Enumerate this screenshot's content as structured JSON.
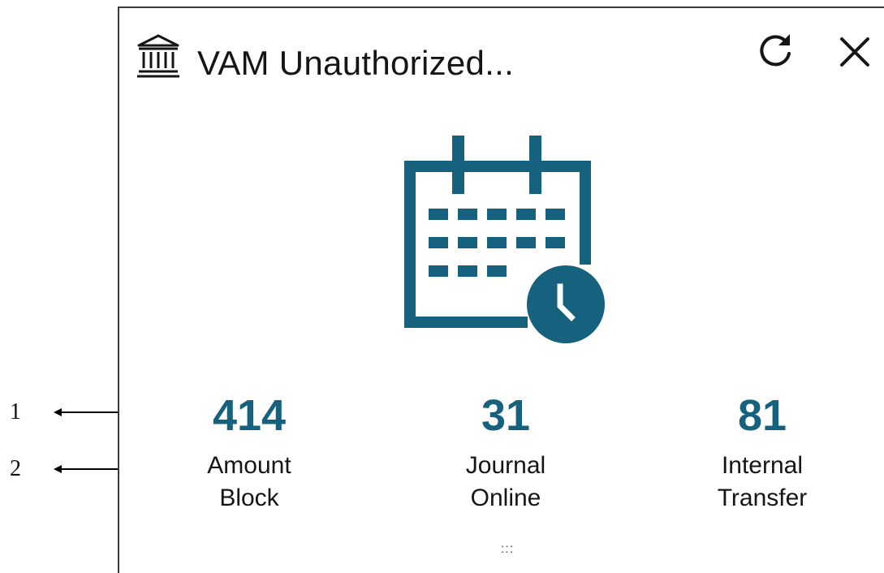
{
  "callouts": [
    {
      "number": "1"
    },
    {
      "number": "2"
    }
  ],
  "widget": {
    "title": "VAM Unauthorized...",
    "icons": {
      "header": "bank-icon",
      "refresh": "refresh-icon",
      "close": "close-icon",
      "illustration": "calendar-clock-icon",
      "drag": "drag-handle-icon"
    },
    "accent_color": "#15617e",
    "metrics": [
      {
        "value": "414",
        "label": "Amount Block"
      },
      {
        "value": "31",
        "label": "Journal Online"
      },
      {
        "value": "81",
        "label": "Internal Transfer"
      }
    ],
    "drag_handle": ":::"
  }
}
